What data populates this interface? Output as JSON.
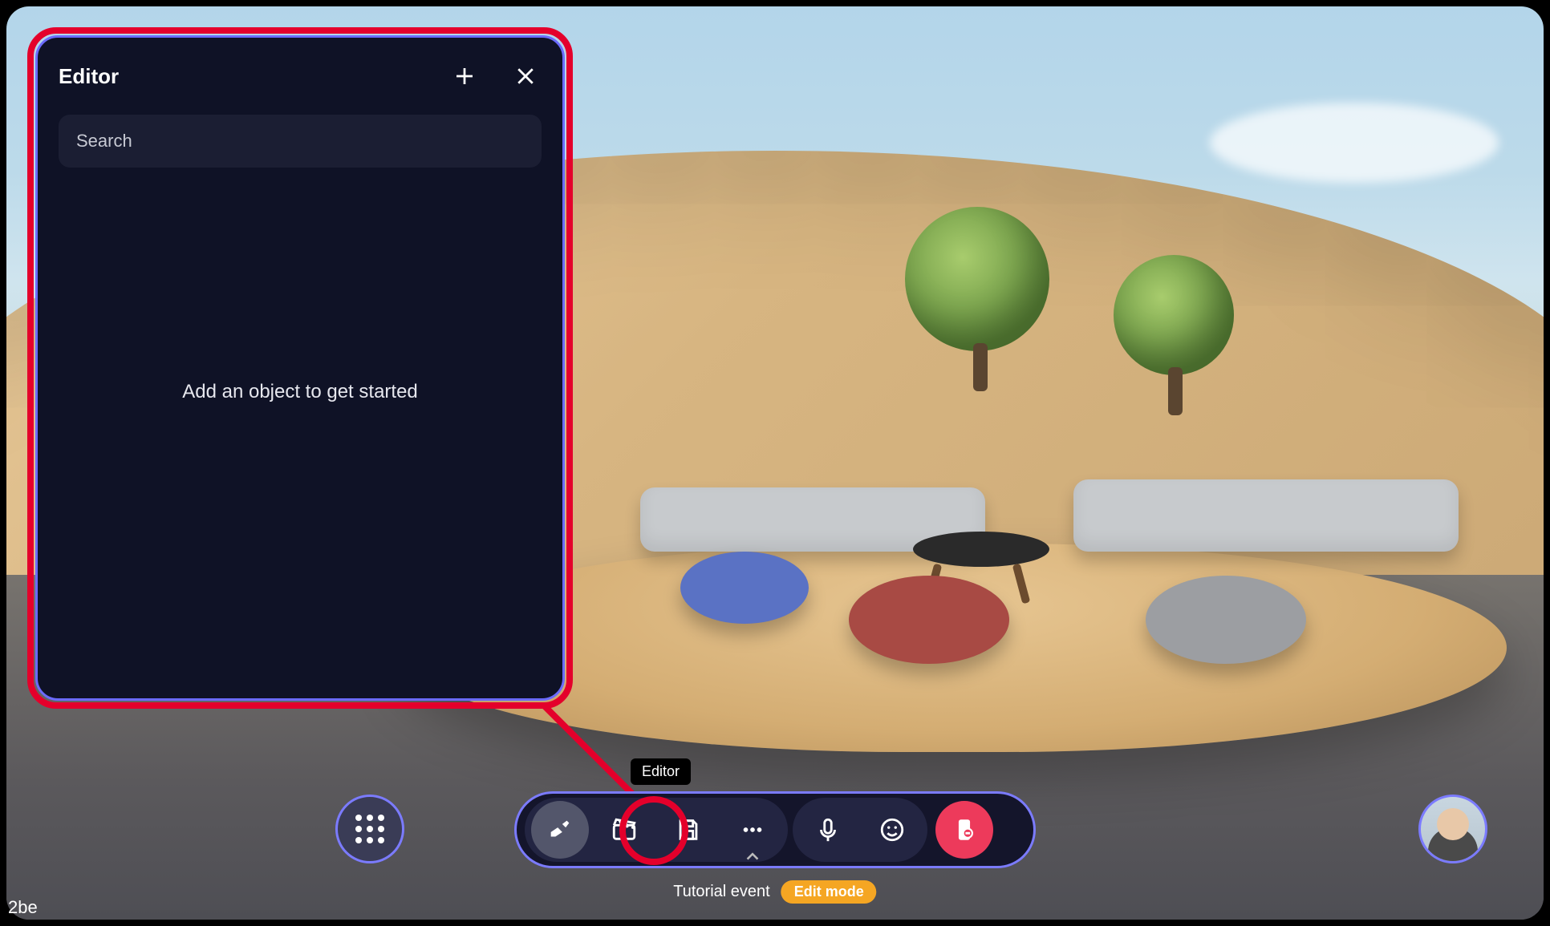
{
  "editor": {
    "title": "Editor",
    "search_placeholder": "Search",
    "empty_message": "Add an object to get started"
  },
  "tooltip": {
    "editor": "Editor"
  },
  "toolbar": {
    "items": [
      {
        "id": "editor",
        "icon": "editor-icon",
        "active": true
      },
      {
        "id": "media",
        "icon": "clapperboard-icon"
      },
      {
        "id": "save",
        "icon": "save-icon"
      },
      {
        "id": "more",
        "icon": "more-icon",
        "has_chevron": true
      },
      {
        "id": "mic",
        "icon": "mic-icon"
      },
      {
        "id": "emoji",
        "icon": "emoji-icon"
      },
      {
        "id": "leave",
        "icon": "leave-icon"
      }
    ]
  },
  "footer": {
    "event_name": "Tutorial event",
    "mode_label": "Edit mode"
  },
  "corner": "2be",
  "colors": {
    "highlight": "#e4002b",
    "panel_bg": "#0f1226",
    "accent_border": "#7b7bff",
    "leave": "#ed3a5b",
    "edit_mode": "#f5a623"
  }
}
